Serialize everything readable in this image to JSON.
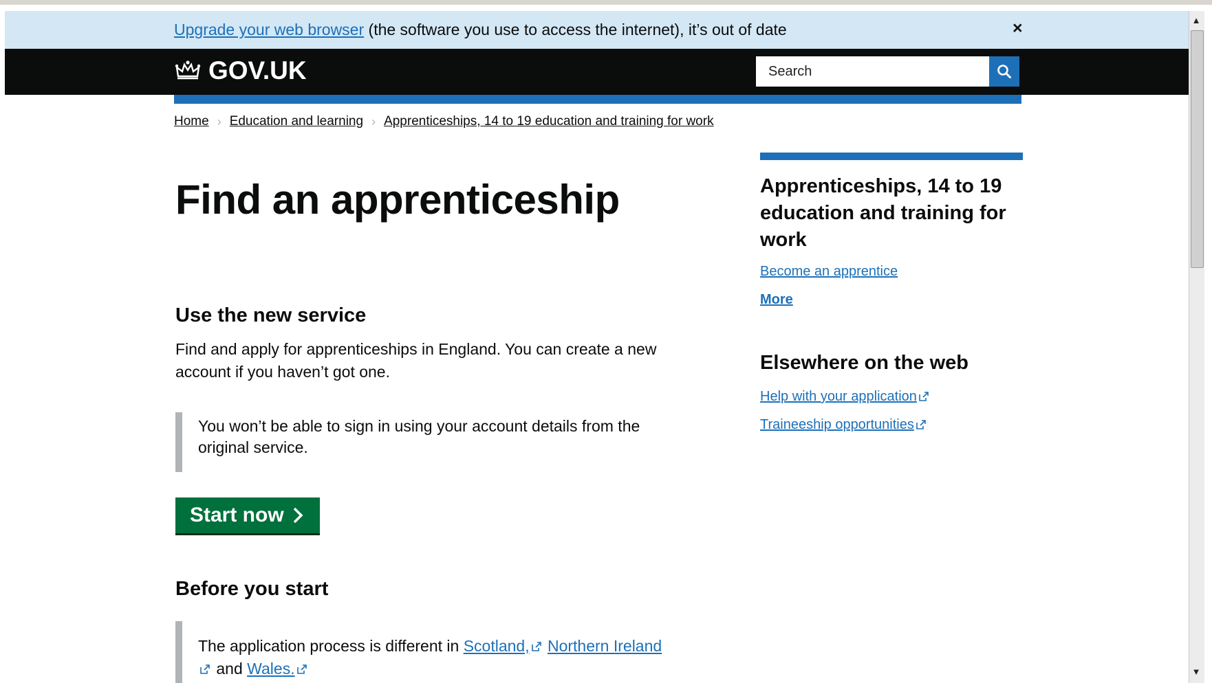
{
  "banner": {
    "link_text": "Upgrade your web browser",
    "text": " (the software you use to access the internet), it’s out of date",
    "close_glyph": "×"
  },
  "header": {
    "logo_text": "GOV.UK",
    "search_placeholder": "Search"
  },
  "breadcrumb": {
    "items": [
      "Home",
      "Education and learning",
      "Apprenticeships, 14 to 19 education and training for work"
    ],
    "separator": "›"
  },
  "main": {
    "title": "Find an apprenticeship",
    "new_service": {
      "heading": "Use the new service",
      "body": "Find and apply for apprenticeships in England. You can create a new account if you haven’t got one.",
      "inset": "You won’t be able to sign in using your account details from the original service."
    },
    "start_button": "Start now",
    "before_start": {
      "heading": "Before you start",
      "inset_prefix": "The application process is different in ",
      "link_scotland": "Scotland,",
      "link_ni": "Northern Ireland",
      "and_text": " and ",
      "link_wales": "Wales."
    }
  },
  "sidebar": {
    "title": "Apprenticeships, 14 to 19 education and training for work",
    "link_become": "Become an apprentice",
    "link_more": "More",
    "elsewhere_heading": "Elsewhere on the web",
    "link_help": "Help with your application",
    "link_traineeship": "Traineeship opportunities"
  },
  "colors": {
    "link": "#1d70b8",
    "header_bg": "#0b0c0c",
    "banner_bg": "#d3e7f5",
    "start_button": "#00703c",
    "inset_border": "#b1b4b6"
  }
}
